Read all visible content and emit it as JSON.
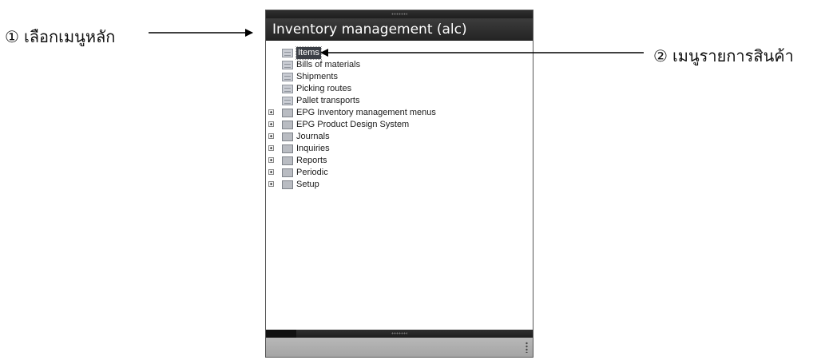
{
  "callouts": [
    {
      "number": "①",
      "text": "เลือกเมนูหลัก"
    },
    {
      "number": "②",
      "text": "เมนูรายการสินค้า"
    }
  ],
  "window": {
    "title": "Inventory management (alc)"
  },
  "tree": {
    "items": [
      {
        "label": "Items",
        "icon": "menu-item-icon",
        "expandable": false,
        "selected": true
      },
      {
        "label": "Bills of materials",
        "icon": "menu-item-icon",
        "expandable": false
      },
      {
        "label": "Shipments",
        "icon": "menu-item-icon",
        "expandable": false
      },
      {
        "label": "Picking routes",
        "icon": "menu-item-icon",
        "expandable": false
      },
      {
        "label": "Pallet transports",
        "icon": "menu-item-icon",
        "expandable": false
      },
      {
        "label": "EPG Inventory management menus",
        "icon": "folder-icon",
        "expandable": true
      },
      {
        "label": "EPG Product Design System",
        "icon": "folder-icon",
        "expandable": true
      },
      {
        "label": "Journals",
        "icon": "folder-icon",
        "expandable": true
      },
      {
        "label": "Inquiries",
        "icon": "folder-icon",
        "expandable": true
      },
      {
        "label": "Reports",
        "icon": "folder-icon",
        "expandable": true
      },
      {
        "label": "Periodic",
        "icon": "folder-icon",
        "expandable": true
      },
      {
        "label": "Setup",
        "icon": "folder-icon",
        "expandable": true
      }
    ]
  },
  "colors": {
    "titlebar": "#2b2b2b",
    "selection": "#3b3f46",
    "statusbar": "#a8a8a8"
  }
}
